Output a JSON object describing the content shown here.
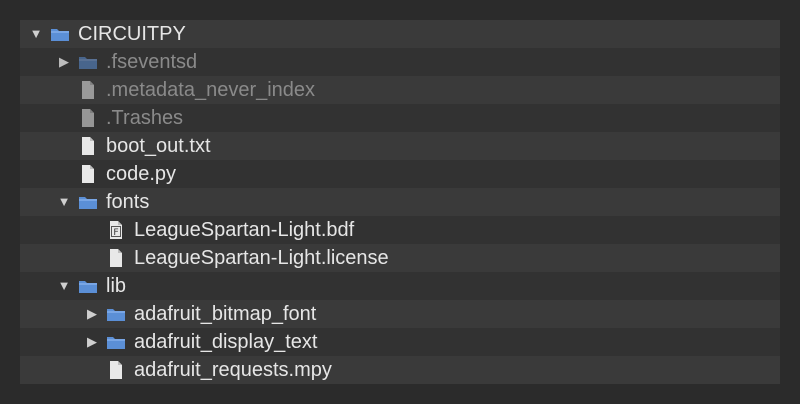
{
  "colors": {
    "background": "#2b2b2b",
    "row_a": "#3a3a3a",
    "row_b": "#323232",
    "text": "#e6e6e6",
    "text_dim": "#8a8a8a",
    "folder": "#5b8fd6",
    "file": "#e8e8e8"
  },
  "tree": {
    "root": {
      "name": "CIRCUITPY",
      "expanded": true,
      "icon": "folder-icon"
    },
    "items": [
      {
        "name": ".fseventsd",
        "expanded": false,
        "icon": "folder-icon",
        "hidden": true
      },
      {
        "name": ".metadata_never_index",
        "icon": "file-icon",
        "hidden": true
      },
      {
        "name": ".Trashes",
        "icon": "file-icon",
        "hidden": true
      },
      {
        "name": "boot_out.txt",
        "icon": "file-icon"
      },
      {
        "name": "code.py",
        "icon": "file-icon"
      },
      {
        "name": "fonts",
        "expanded": true,
        "icon": "folder-icon"
      },
      {
        "name": "LeagueSpartan-Light.bdf",
        "icon": "font-file-icon",
        "badge": "F"
      },
      {
        "name": "LeagueSpartan-Light.license",
        "icon": "file-icon"
      },
      {
        "name": "lib",
        "expanded": true,
        "icon": "folder-icon"
      },
      {
        "name": "adafruit_bitmap_font",
        "expanded": false,
        "icon": "folder-icon"
      },
      {
        "name": "adafruit_display_text",
        "expanded": false,
        "icon": "folder-icon"
      },
      {
        "name": "adafruit_requests.mpy",
        "icon": "file-icon"
      }
    ]
  }
}
